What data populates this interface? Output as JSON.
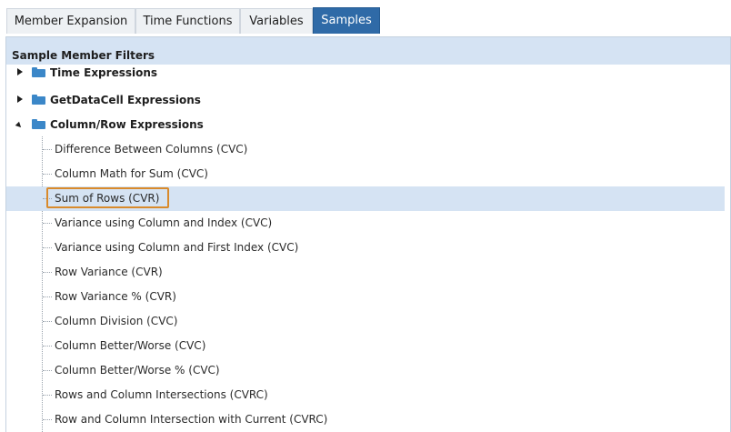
{
  "tabs": [
    {
      "label": "Member Expansion"
    },
    {
      "label": "Time Functions"
    },
    {
      "label": "Variables"
    },
    {
      "label": "Samples"
    }
  ],
  "panel": {
    "header": "Sample Member Filters"
  },
  "tree": {
    "groups": [
      {
        "label": "Time Expressions",
        "state": "collapsed"
      },
      {
        "label": "GetDataCell Expressions",
        "state": "collapsed"
      },
      {
        "label": "Column/Row Expressions",
        "state": "expanded"
      }
    ],
    "items": [
      {
        "label": "Difference Between Columns (CVC)"
      },
      {
        "label": "Column Math for Sum (CVC)"
      },
      {
        "label": "Sum of Rows (CVR)",
        "selected": true
      },
      {
        "label": "Variance using Column and Index (CVC)"
      },
      {
        "label": "Variance using Column and First Index (CVC)"
      },
      {
        "label": "Row Variance (CVR)"
      },
      {
        "label": "Row Variance % (CVR)"
      },
      {
        "label": "Column Division (CVC)"
      },
      {
        "label": "Column Better/Worse (CVC)"
      },
      {
        "label": "Column Better/Worse % (CVC)"
      },
      {
        "label": "Rows and Column Intersections (CVRC)"
      },
      {
        "label": "Row and Column Intersection with Current (CVRC)"
      }
    ]
  },
  "colors": {
    "active_tab": "#2f6aa7",
    "header_bg": "#d5e3f3",
    "folder": "#3b87c8",
    "highlight": "#d98a2b"
  }
}
